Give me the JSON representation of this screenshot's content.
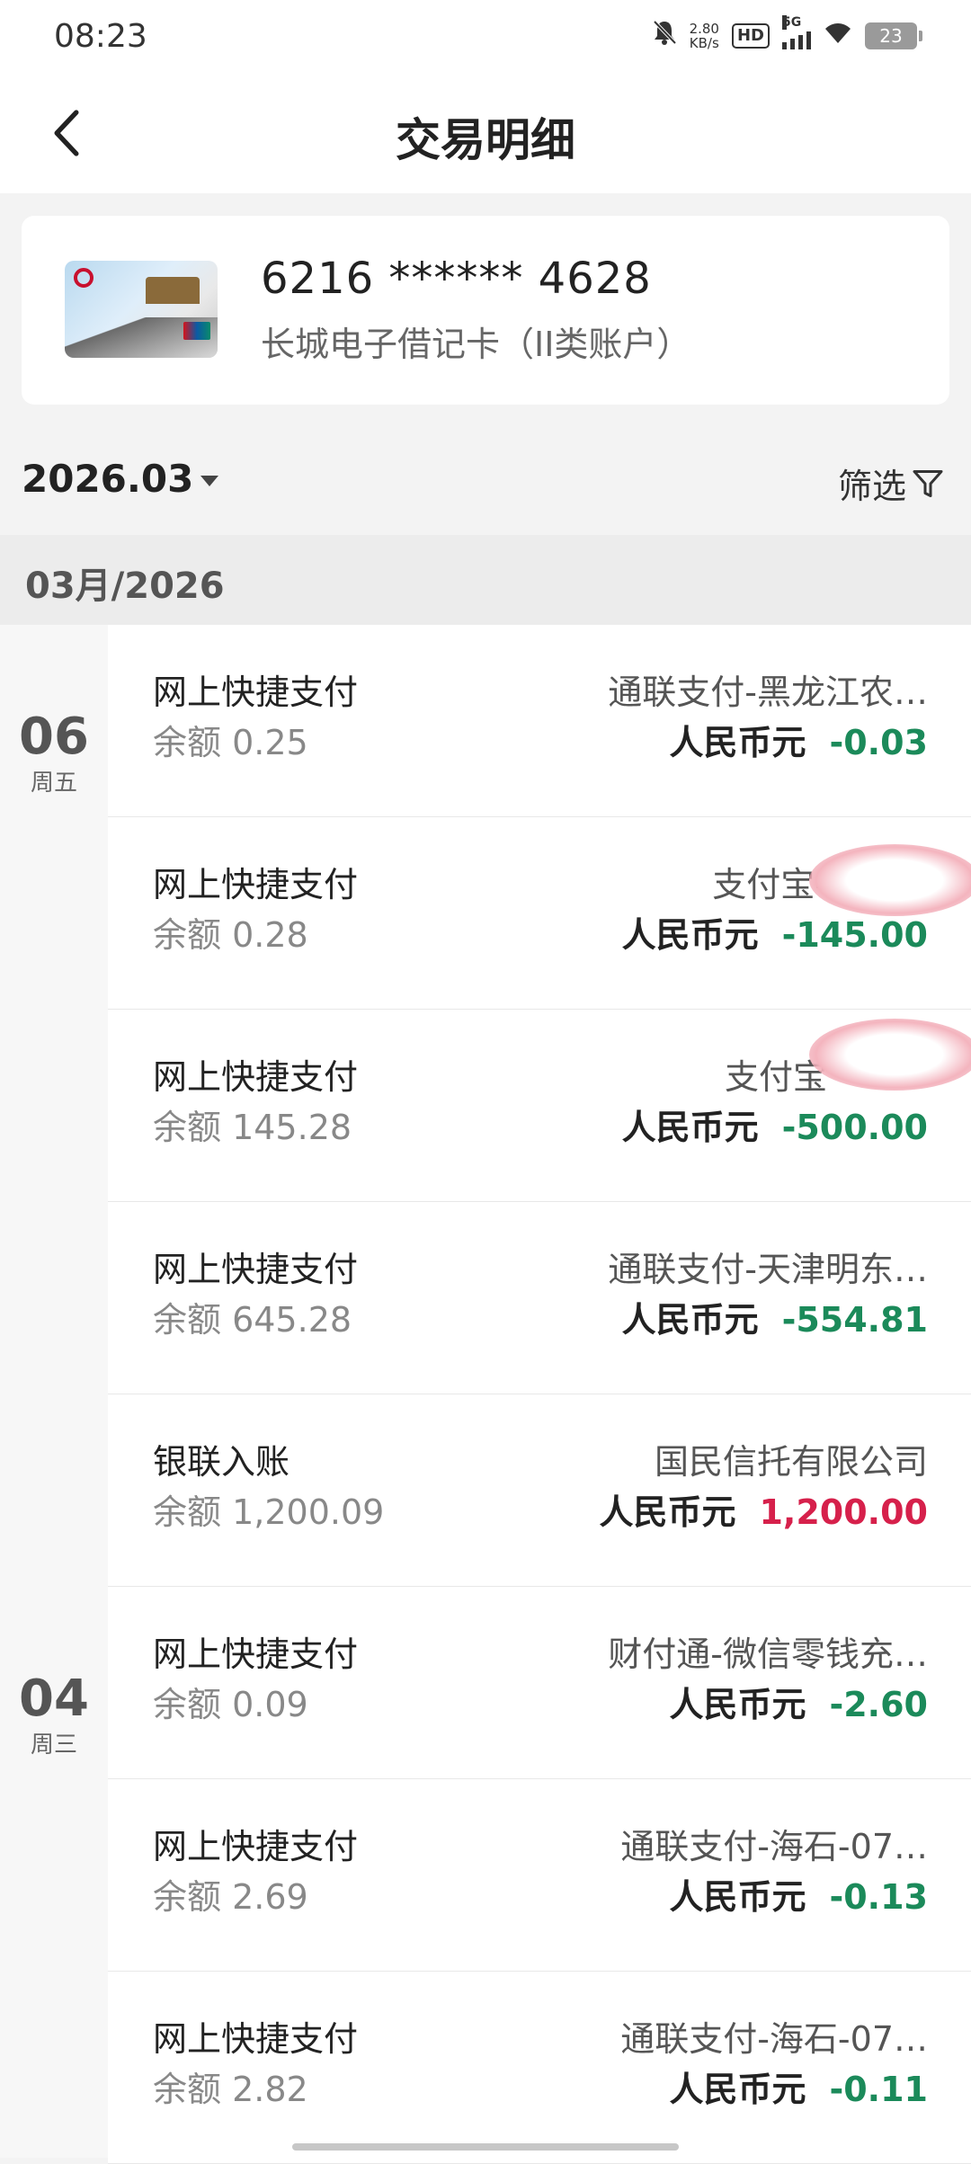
{
  "status_bar": {
    "time": "08:23",
    "net_speed_value": "2.80",
    "net_speed_unit": "KB/s",
    "hd_label": "HD",
    "signal_label": "5G",
    "battery_level": "23"
  },
  "header": {
    "title": "交易明细"
  },
  "card": {
    "number": "6216 ****** 4628",
    "type": "长城电子借记卡（II类账户）"
  },
  "filter": {
    "month": "2026.03",
    "filter_label": "筛选"
  },
  "month_header": "03月/2026",
  "days": [
    {
      "day": "06",
      "weekday": "周五"
    },
    {
      "day": "04",
      "weekday": "周三"
    }
  ],
  "transactions": [
    {
      "type": "网上快捷支付",
      "balance": "余额 0.25",
      "counterparty": "通联支付-黑龙江农…",
      "currency": "人民币元",
      "amount": "-0.03",
      "direction": "neg"
    },
    {
      "type": "网上快捷支付",
      "balance": "余额 0.28",
      "counterparty": "支付宝-",
      "currency": "人民币元",
      "amount": "-145.00",
      "direction": "neg"
    },
    {
      "type": "网上快捷支付",
      "balance": "余额 145.28",
      "counterparty": "支付宝",
      "currency": "人民币元",
      "amount": "-500.00",
      "direction": "neg"
    },
    {
      "type": "网上快捷支付",
      "balance": "余额 645.28",
      "counterparty": "通联支付-天津明东…",
      "currency": "人民币元",
      "amount": "-554.81",
      "direction": "neg"
    },
    {
      "type": "银联入账",
      "balance": "余额 1,200.09",
      "counterparty": "国民信托有限公司",
      "currency": "人民币元",
      "amount": "1,200.00",
      "direction": "pos"
    },
    {
      "type": "网上快捷支付",
      "balance": "余额 0.09",
      "counterparty": "财付通-微信零钱充…",
      "currency": "人民币元",
      "amount": "-2.60",
      "direction": "neg"
    },
    {
      "type": "网上快捷支付",
      "balance": "余额 2.69",
      "counterparty": "通联支付-海石-07…",
      "currency": "人民币元",
      "amount": "-0.13",
      "direction": "neg"
    },
    {
      "type": "网上快捷支付",
      "balance": "余额 2.82",
      "counterparty": "通联支付-海石-07…",
      "currency": "人民币元",
      "amount": "-0.11",
      "direction": "neg"
    }
  ],
  "colors": {
    "negative": "#1b8a5a",
    "positive": "#d6204b"
  }
}
